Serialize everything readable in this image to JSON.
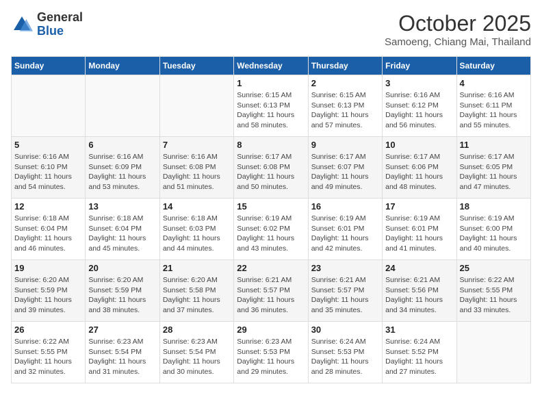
{
  "header": {
    "logo_general": "General",
    "logo_blue": "Blue",
    "month": "October 2025",
    "location": "Samoeng, Chiang Mai, Thailand"
  },
  "days_of_week": [
    "Sunday",
    "Monday",
    "Tuesday",
    "Wednesday",
    "Thursday",
    "Friday",
    "Saturday"
  ],
  "weeks": [
    [
      {
        "day": "",
        "info": ""
      },
      {
        "day": "",
        "info": ""
      },
      {
        "day": "",
        "info": ""
      },
      {
        "day": "1",
        "info": "Sunrise: 6:15 AM\nSunset: 6:13 PM\nDaylight: 11 hours\nand 58 minutes."
      },
      {
        "day": "2",
        "info": "Sunrise: 6:15 AM\nSunset: 6:13 PM\nDaylight: 11 hours\nand 57 minutes."
      },
      {
        "day": "3",
        "info": "Sunrise: 6:16 AM\nSunset: 6:12 PM\nDaylight: 11 hours\nand 56 minutes."
      },
      {
        "day": "4",
        "info": "Sunrise: 6:16 AM\nSunset: 6:11 PM\nDaylight: 11 hours\nand 55 minutes."
      }
    ],
    [
      {
        "day": "5",
        "info": "Sunrise: 6:16 AM\nSunset: 6:10 PM\nDaylight: 11 hours\nand 54 minutes."
      },
      {
        "day": "6",
        "info": "Sunrise: 6:16 AM\nSunset: 6:09 PM\nDaylight: 11 hours\nand 53 minutes."
      },
      {
        "day": "7",
        "info": "Sunrise: 6:16 AM\nSunset: 6:08 PM\nDaylight: 11 hours\nand 51 minutes."
      },
      {
        "day": "8",
        "info": "Sunrise: 6:17 AM\nSunset: 6:08 PM\nDaylight: 11 hours\nand 50 minutes."
      },
      {
        "day": "9",
        "info": "Sunrise: 6:17 AM\nSunset: 6:07 PM\nDaylight: 11 hours\nand 49 minutes."
      },
      {
        "day": "10",
        "info": "Sunrise: 6:17 AM\nSunset: 6:06 PM\nDaylight: 11 hours\nand 48 minutes."
      },
      {
        "day": "11",
        "info": "Sunrise: 6:17 AM\nSunset: 6:05 PM\nDaylight: 11 hours\nand 47 minutes."
      }
    ],
    [
      {
        "day": "12",
        "info": "Sunrise: 6:18 AM\nSunset: 6:04 PM\nDaylight: 11 hours\nand 46 minutes."
      },
      {
        "day": "13",
        "info": "Sunrise: 6:18 AM\nSunset: 6:04 PM\nDaylight: 11 hours\nand 45 minutes."
      },
      {
        "day": "14",
        "info": "Sunrise: 6:18 AM\nSunset: 6:03 PM\nDaylight: 11 hours\nand 44 minutes."
      },
      {
        "day": "15",
        "info": "Sunrise: 6:19 AM\nSunset: 6:02 PM\nDaylight: 11 hours\nand 43 minutes."
      },
      {
        "day": "16",
        "info": "Sunrise: 6:19 AM\nSunset: 6:01 PM\nDaylight: 11 hours\nand 42 minutes."
      },
      {
        "day": "17",
        "info": "Sunrise: 6:19 AM\nSunset: 6:01 PM\nDaylight: 11 hours\nand 41 minutes."
      },
      {
        "day": "18",
        "info": "Sunrise: 6:19 AM\nSunset: 6:00 PM\nDaylight: 11 hours\nand 40 minutes."
      }
    ],
    [
      {
        "day": "19",
        "info": "Sunrise: 6:20 AM\nSunset: 5:59 PM\nDaylight: 11 hours\nand 39 minutes."
      },
      {
        "day": "20",
        "info": "Sunrise: 6:20 AM\nSunset: 5:59 PM\nDaylight: 11 hours\nand 38 minutes."
      },
      {
        "day": "21",
        "info": "Sunrise: 6:20 AM\nSunset: 5:58 PM\nDaylight: 11 hours\nand 37 minutes."
      },
      {
        "day": "22",
        "info": "Sunrise: 6:21 AM\nSunset: 5:57 PM\nDaylight: 11 hours\nand 36 minutes."
      },
      {
        "day": "23",
        "info": "Sunrise: 6:21 AM\nSunset: 5:57 PM\nDaylight: 11 hours\nand 35 minutes."
      },
      {
        "day": "24",
        "info": "Sunrise: 6:21 AM\nSunset: 5:56 PM\nDaylight: 11 hours\nand 34 minutes."
      },
      {
        "day": "25",
        "info": "Sunrise: 6:22 AM\nSunset: 5:55 PM\nDaylight: 11 hours\nand 33 minutes."
      }
    ],
    [
      {
        "day": "26",
        "info": "Sunrise: 6:22 AM\nSunset: 5:55 PM\nDaylight: 11 hours\nand 32 minutes."
      },
      {
        "day": "27",
        "info": "Sunrise: 6:23 AM\nSunset: 5:54 PM\nDaylight: 11 hours\nand 31 minutes."
      },
      {
        "day": "28",
        "info": "Sunrise: 6:23 AM\nSunset: 5:54 PM\nDaylight: 11 hours\nand 30 minutes."
      },
      {
        "day": "29",
        "info": "Sunrise: 6:23 AM\nSunset: 5:53 PM\nDaylight: 11 hours\nand 29 minutes."
      },
      {
        "day": "30",
        "info": "Sunrise: 6:24 AM\nSunset: 5:53 PM\nDaylight: 11 hours\nand 28 minutes."
      },
      {
        "day": "31",
        "info": "Sunrise: 6:24 AM\nSunset: 5:52 PM\nDaylight: 11 hours\nand 27 minutes."
      },
      {
        "day": "",
        "info": ""
      }
    ]
  ]
}
